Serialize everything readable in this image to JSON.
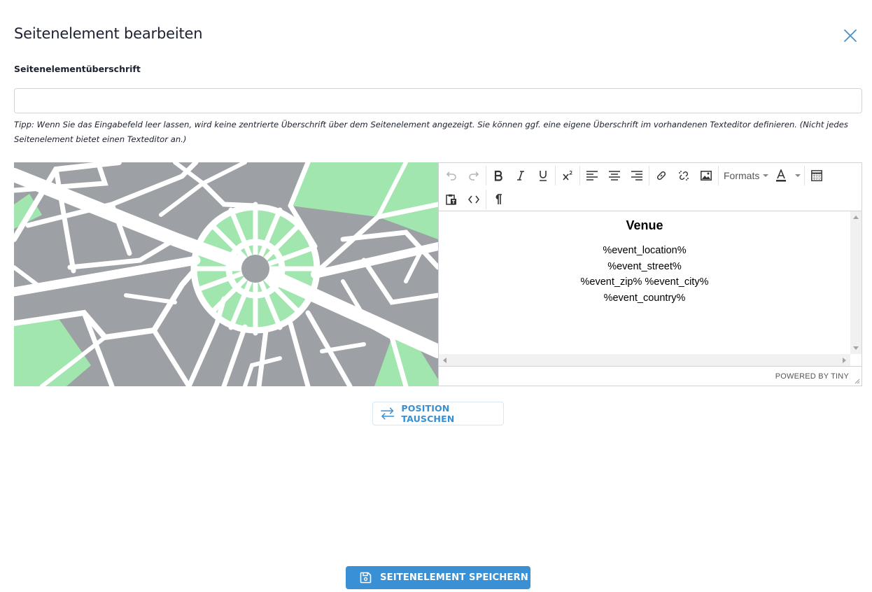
{
  "modal": {
    "title": "Seitenelement bearbeiten",
    "close_icon": "close-x-icon"
  },
  "heading_field": {
    "label": "Seitenelementüberschrift",
    "value": "",
    "placeholder": "",
    "hint": "Tipp: Wenn Sie das Eingabefeld leer lassen, wird keine zentrierte Überschrift über dem Seitenelement angezeigt. Sie können ggf. eine eigene Überschrift im vorhandenen Texteditor definieren. (Nicht jedes Seitenelement bietet einen Texteditor an.)"
  },
  "map_image": {
    "icon": "city-map-illustration",
    "colors": {
      "blocks": "#9da0a4",
      "parks": "#a0e6ae",
      "roads": "#ffffff"
    }
  },
  "editor": {
    "toolbar": {
      "row1": [
        "undo-icon",
        "redo-icon",
        "bold-icon",
        "italic-icon",
        "underline-icon",
        "superscript-icon",
        "align-left-icon",
        "align-center-icon",
        "align-right-icon",
        "link-icon",
        "unlink-icon",
        "image-icon",
        "formats-dropdown",
        "font-color-icon",
        "table-icon"
      ],
      "row2": [
        "paste-text-icon",
        "source-code-icon",
        "paragraph-mark-icon"
      ],
      "formats_label": "Formats",
      "font_color_letter": "A"
    },
    "content": {
      "heading": "Venue",
      "lines": [
        "%event_location%",
        "%event_street%",
        "%event_zip% %event_city%",
        "%event_country%"
      ]
    },
    "statusbar": {
      "powered_by": "POWERED BY TINY"
    }
  },
  "actions": {
    "swap_label": "POSITION TAUSCHEN",
    "swap_icon": "swap-arrows-icon",
    "save_label": "SEITENELEMENT SPEICHERN",
    "save_icon": "floppy-disk-icon"
  },
  "colors": {
    "accent": "#3a90d4",
    "text": "#1d2130",
    "border": "#cfd3d8"
  }
}
